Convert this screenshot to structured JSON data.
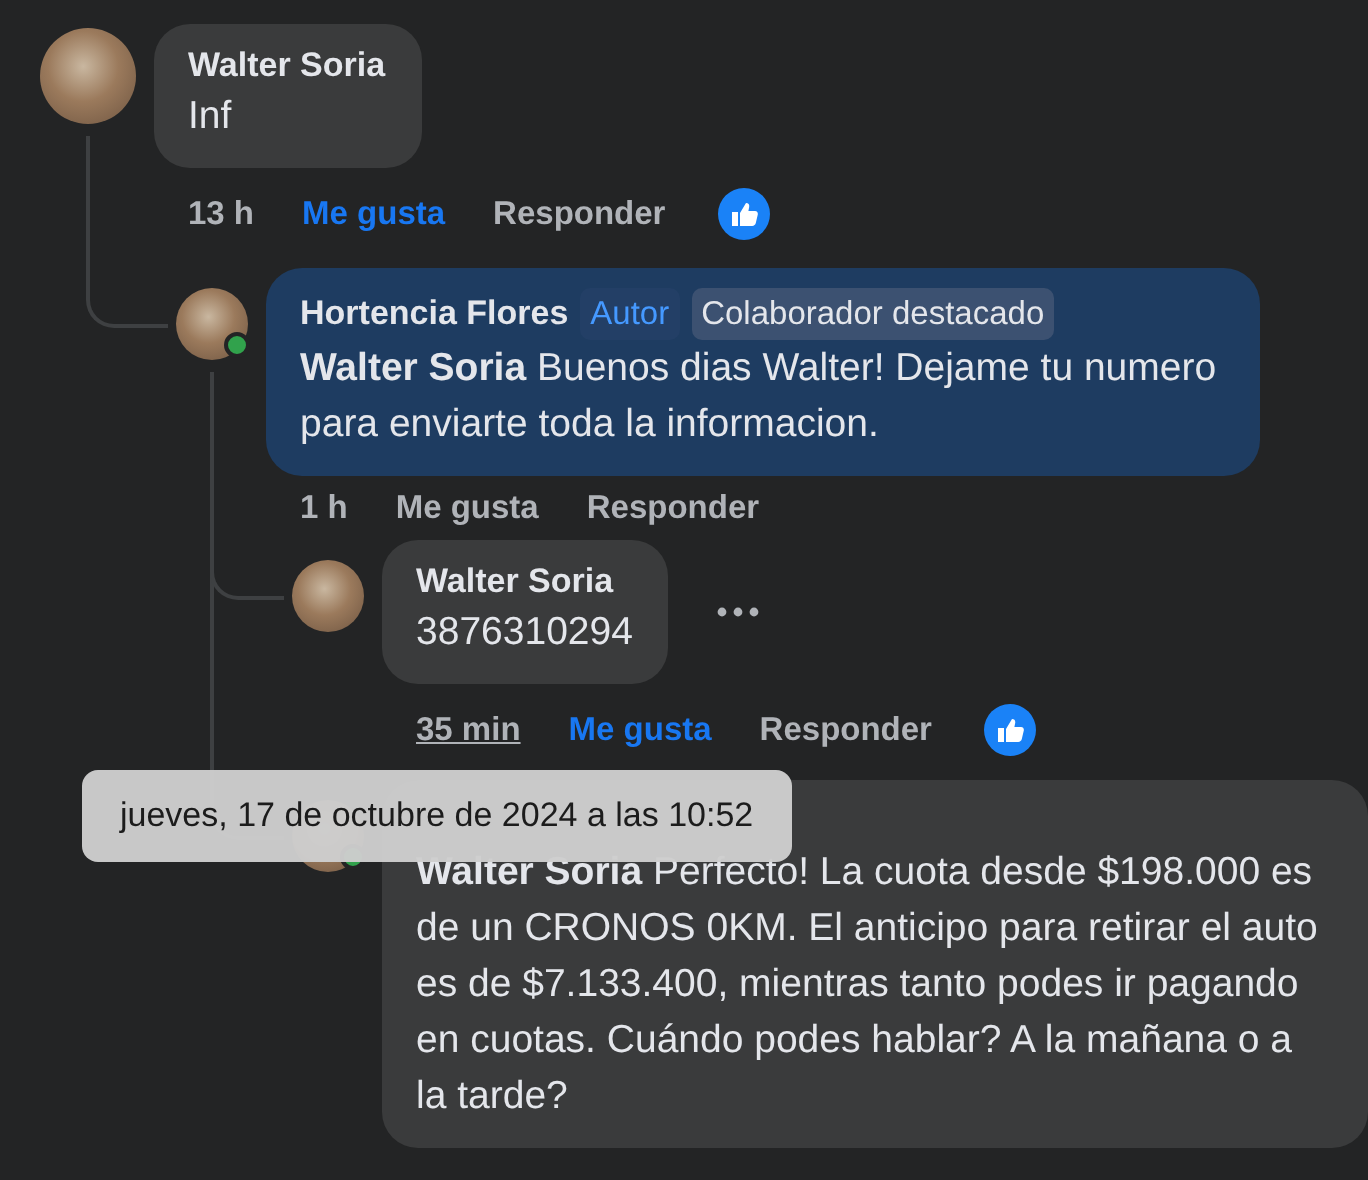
{
  "comments": [
    {
      "author": "Walter Soria",
      "text": "Inf",
      "highlighted": false,
      "time": "13 h",
      "time_hovered": false,
      "like_label": "Me gusta",
      "liked": true,
      "reply_label": "Responder",
      "has_reaction": true,
      "replies": [
        {
          "author": "Hortencia Flores",
          "badges": [
            {
              "label": "Autor",
              "kind": "author"
            },
            {
              "label": "Colaborador destacado",
              "kind": "top"
            }
          ],
          "text": "**Walter Soria** Buenos dias Walter! Dejame tu numero para enviarte toda la informacion.",
          "highlighted": true,
          "online": true,
          "time": "1 h",
          "time_hovered": false,
          "like_label": "Me gusta",
          "liked": false,
          "reply_label": "Responder",
          "replies": [
            {
              "author": "Walter Soria",
              "text": "3876310294",
              "highlighted": false,
              "time": "35 min",
              "time_hovered": true,
              "like_label": "Me gusta",
              "liked": true,
              "reply_label": "Responder",
              "has_reaction": true,
              "more_menu": true
            },
            {
              "text": "**Walter Soria** Perfecto! La cuota desde $198.000 es de un CRONOS 0KM. El anticipo para retirar el auto es de $7.133.400, mientras tanto podes ir pagando en cuotas. Cuándo podes hablar? A la mañana o a la tarde?",
              "highlighted": false,
              "online": true
            }
          ]
        }
      ]
    }
  ],
  "tooltip": {
    "text": "jueves, 17 de octubre de 2024 a las 10:52"
  }
}
